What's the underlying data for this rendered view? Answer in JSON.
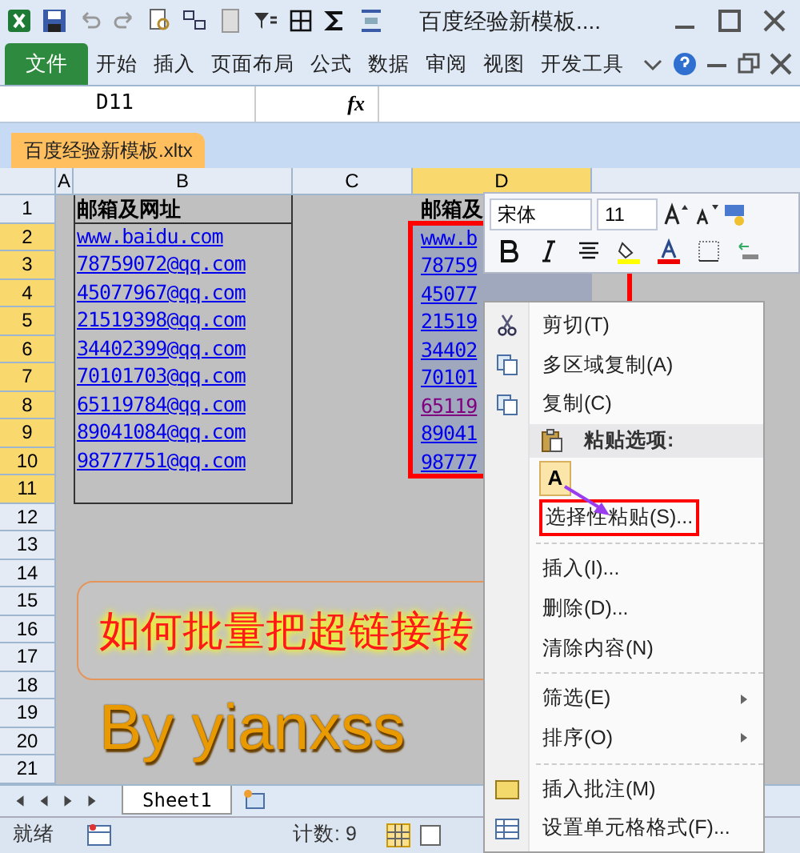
{
  "title_bar": {
    "title": "百度经验新模板...."
  },
  "ribbon": {
    "file_tab": "文件",
    "tabs": [
      "开始",
      "插入",
      "页面布局",
      "公式",
      "数据",
      "审阅",
      "视图",
      "开发工具"
    ]
  },
  "name_box": "D11",
  "formula_label": "fx",
  "doc_tab": "百度经验新模板.xltx",
  "columns": [
    {
      "label": "A",
      "selected": false
    },
    {
      "label": "B",
      "selected": false
    },
    {
      "label": "C",
      "selected": false
    },
    {
      "label": "D",
      "selected": true
    }
  ],
  "rows": [
    {
      "label": "1",
      "selected": false
    },
    {
      "label": "2",
      "selected": true
    },
    {
      "label": "3",
      "selected": true
    },
    {
      "label": "4",
      "selected": true
    },
    {
      "label": "5",
      "selected": true
    },
    {
      "label": "6",
      "selected": true
    },
    {
      "label": "7",
      "selected": true
    },
    {
      "label": "8",
      "selected": true
    },
    {
      "label": "9",
      "selected": true
    },
    {
      "label": "10",
      "selected": true
    },
    {
      "label": "11",
      "selected": true
    },
    {
      "label": "12",
      "selected": false
    },
    {
      "label": "13",
      "selected": false
    },
    {
      "label": "14",
      "selected": false
    },
    {
      "label": "15",
      "selected": false
    },
    {
      "label": "16",
      "selected": false
    },
    {
      "label": "17",
      "selected": false
    },
    {
      "label": "18",
      "selected": false
    },
    {
      "label": "19",
      "selected": false
    },
    {
      "label": "20",
      "selected": false
    },
    {
      "label": "21",
      "selected": false
    }
  ],
  "column_b": {
    "header": "邮箱及网址",
    "links": [
      {
        "text": "www.baidu.com",
        "visited": false
      },
      {
        "text": "78759072@qq.com",
        "visited": false
      },
      {
        "text": "45077967@qq.com",
        "visited": false
      },
      {
        "text": "21519398@qq.com",
        "visited": false
      },
      {
        "text": "34402399@qq.com",
        "visited": false
      },
      {
        "text": "70101703@qq.com",
        "visited": false
      },
      {
        "text": "65119784@qq.com",
        "visited": false
      },
      {
        "text": "89041084@qq.com",
        "visited": false
      },
      {
        "text": "98777751@qq.com",
        "visited": false
      }
    ]
  },
  "column_d": {
    "header": "邮箱及",
    "links": [
      {
        "text": "www.b",
        "visited": false
      },
      {
        "text": "78759",
        "visited": false
      },
      {
        "text": "45077",
        "visited": false
      },
      {
        "text": "21519",
        "visited": false
      },
      {
        "text": "34402",
        "visited": false
      },
      {
        "text": "70101",
        "visited": false
      },
      {
        "text": "65119",
        "visited": true
      },
      {
        "text": "89041",
        "visited": false
      },
      {
        "text": "98777",
        "visited": false
      }
    ]
  },
  "wordart": {
    "title": "如何批量把超链接转",
    "byline": "By yianxss"
  },
  "mini_toolbar": {
    "font": "宋体",
    "size": "11"
  },
  "context_menu": [
    {
      "kind": "item",
      "label": "剪切(T)",
      "annotated": false,
      "submenu": false
    },
    {
      "kind": "item",
      "label": "多区域复制(A)",
      "annotated": false,
      "submenu": false
    },
    {
      "kind": "item",
      "label": "复制(C)",
      "annotated": false,
      "submenu": false
    },
    {
      "kind": "header",
      "label": "粘贴选项:"
    },
    {
      "kind": "paste",
      "label": "A"
    },
    {
      "kind": "item",
      "label": "选择性粘贴(S)...",
      "annotated": true,
      "submenu": false
    },
    {
      "kind": "separator"
    },
    {
      "kind": "item",
      "label": "插入(I)...",
      "annotated": false,
      "submenu": false
    },
    {
      "kind": "item",
      "label": "删除(D)...",
      "annotated": false,
      "submenu": false
    },
    {
      "kind": "item",
      "label": "清除内容(N)",
      "annotated": false,
      "submenu": false
    },
    {
      "kind": "separator"
    },
    {
      "kind": "item",
      "label": "筛选(E)",
      "annotated": false,
      "submenu": true
    },
    {
      "kind": "item",
      "label": "排序(O)",
      "annotated": false,
      "submenu": true
    },
    {
      "kind": "separator"
    },
    {
      "kind": "item",
      "label": "插入批注(M)",
      "annotated": false,
      "submenu": false
    },
    {
      "kind": "item",
      "label": "设置单元格格式(F)...",
      "annotated": false,
      "submenu": false
    }
  ],
  "sheet_tabs": [
    {
      "label": "Sheet1",
      "selected": true
    }
  ],
  "status_bar": {
    "ready": "就绪",
    "count": "计数: 9"
  }
}
